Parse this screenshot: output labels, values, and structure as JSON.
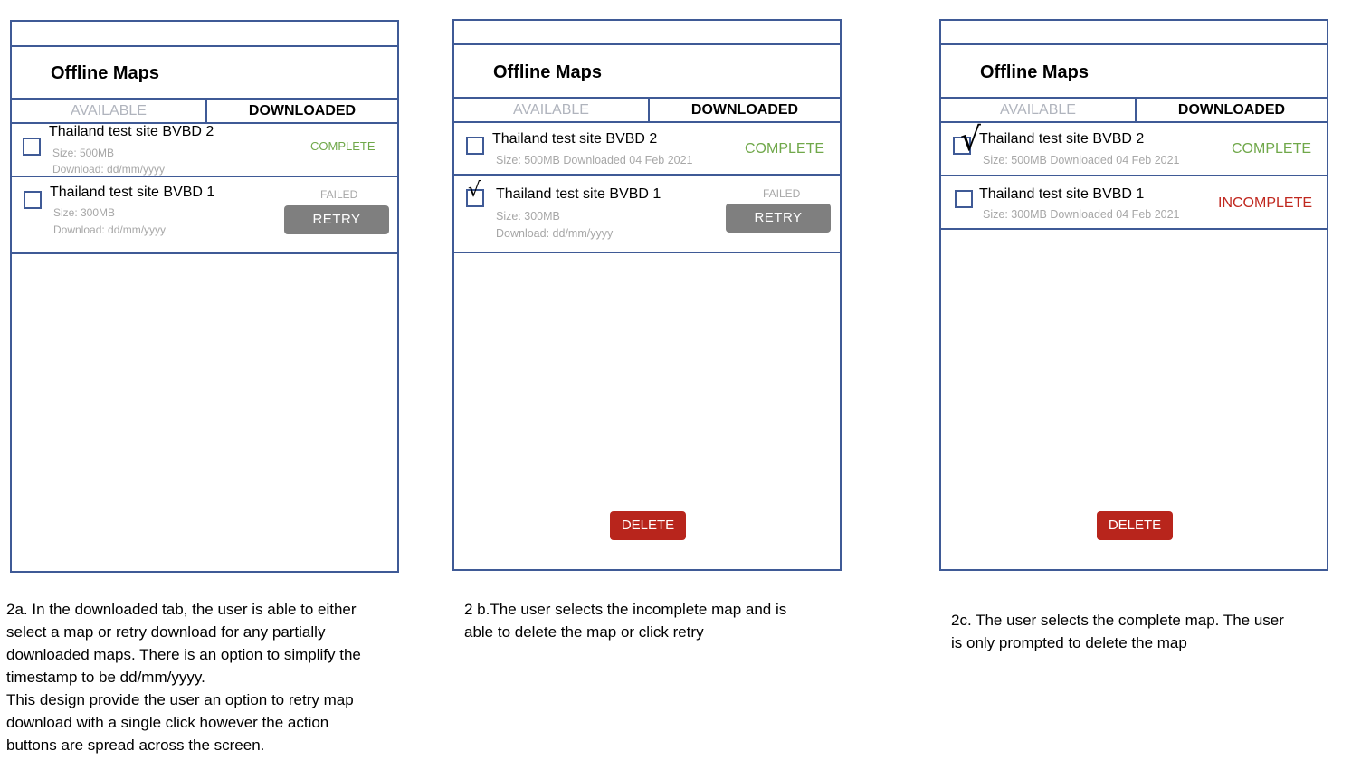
{
  "screens": [
    {
      "title": "Offline Maps",
      "tabs": {
        "available": "AVAILABLE",
        "downloaded": "DOWNLOADED"
      },
      "items": [
        {
          "name": "Thailand test site BVBD 2",
          "size": "Size: 500MB",
          "download": "Download: dd/mm/yyyy",
          "status": "COMPLETE"
        },
        {
          "name": "Thailand test site BVBD 1",
          "size": "Size: 300MB",
          "download": "Download: dd/mm/yyyy",
          "status": "FAILED",
          "retry": "RETRY"
        }
      ],
      "caption": [
        "2a. In the downloaded tab, the user is able to either",
        "select a map or retry download for any partially",
        "downloaded maps. There is an option to simplify the",
        "timestamp to be dd/mm/yyyy.",
        "This design provide the user an option to retry map",
        "download with a single click however the action",
        "buttons are spread across the screen."
      ]
    },
    {
      "title": "Offline Maps",
      "tabs": {
        "available": "AVAILABLE",
        "downloaded": "DOWNLOADED"
      },
      "items": [
        {
          "name": "Thailand test site BVBD 2",
          "meta": "Size: 500MB Downloaded 04 Feb 2021",
          "status": "COMPLETE",
          "checked": false
        },
        {
          "name": "Thailand test site BVBD 1",
          "size": "Size: 300MB",
          "download": "Download: dd/mm/yyyy",
          "status": "FAILED",
          "retry": "RETRY",
          "checked": true,
          "check_glyph": "√"
        }
      ],
      "delete_label": "DELETE",
      "caption": [
        "2 b.The user selects the incomplete map and is",
        "able to delete the map or click retry"
      ]
    },
    {
      "title": "Offline Maps",
      "tabs": {
        "available": "AVAILABLE",
        "downloaded": "DOWNLOADED"
      },
      "items": [
        {
          "name": "Thailand test site BVBD 2",
          "meta": "Size: 500MB Downloaded 04 Feb 2021",
          "status": "COMPLETE",
          "checked": true,
          "check_glyph": "√"
        },
        {
          "name": "Thailand test site BVBD 1",
          "meta": "Size: 300MB Downloaded 04 Feb 2021",
          "status": "INCOMPLETE",
          "checked": false
        }
      ],
      "delete_label": "DELETE",
      "caption": [
        "2c. The user selects the complete map. The user",
        "is only prompted to delete the map"
      ]
    }
  ],
  "colors": {
    "frame_border": "#3f5a96",
    "complete": "#70a84a",
    "incomplete": "#c0281f",
    "muted": "#a7a7a7",
    "retry_bg": "#7f7f7f",
    "delete_bg": "#b8251c"
  }
}
